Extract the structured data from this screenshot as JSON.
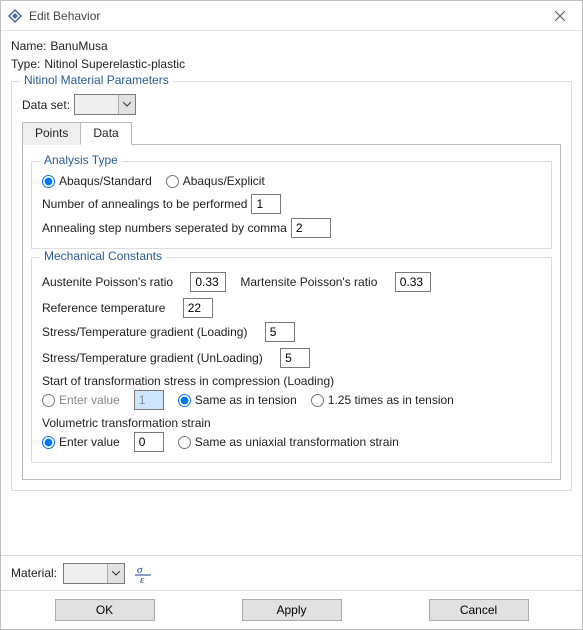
{
  "window": {
    "title": "Edit Behavior"
  },
  "header": {
    "name_label": "Name:",
    "name_value": "BanuMusa",
    "type_label": "Type:",
    "type_value": "Nitinol Superelastic-plastic"
  },
  "params_group_legend": "Nitinol Material Parameters",
  "dataset_label": "Data set:",
  "dataset_value": "",
  "tabs": {
    "points": "Points",
    "data": "Data"
  },
  "analysis": {
    "legend": "Analysis Type",
    "standard": "Abaqus/Standard",
    "explicit": "Abaqus/Explicit",
    "anneal_count_label": "Number of annealings to be performed",
    "anneal_count_value": "1",
    "anneal_steps_label": "Annealing step numbers seperated by comma",
    "anneal_steps_value": "2"
  },
  "mech": {
    "legend": "Mechanical Constants",
    "aust_label": "Austenite Poisson's ratio",
    "aust_value": "0.33",
    "mart_label": "Martensite Poisson's ratio",
    "mart_value": "0.33",
    "reft_label": "Reference temperature",
    "reft_value": "22",
    "grad_load_label": "Stress/Temperature gradient (Loading)",
    "grad_load_value": "5",
    "grad_unload_label": "Stress/Temperature gradient (UnLoading)",
    "grad_unload_value": "5",
    "soc_header": "Start of transformation stress in compression (Loading)",
    "soc_enter_label": "Enter value",
    "soc_enter_value": "1",
    "soc_same": "Same as in tension",
    "soc_125": "1.25 times as in tension",
    "vts_header": "Volumetric transformation strain",
    "vts_enter_label": "Enter value",
    "vts_enter_value": "0",
    "vts_same": "Same as uniaxial transformation strain"
  },
  "material_label": "Material:",
  "material_value": "",
  "buttons": {
    "ok": "OK",
    "apply": "Apply",
    "cancel": "Cancel"
  }
}
